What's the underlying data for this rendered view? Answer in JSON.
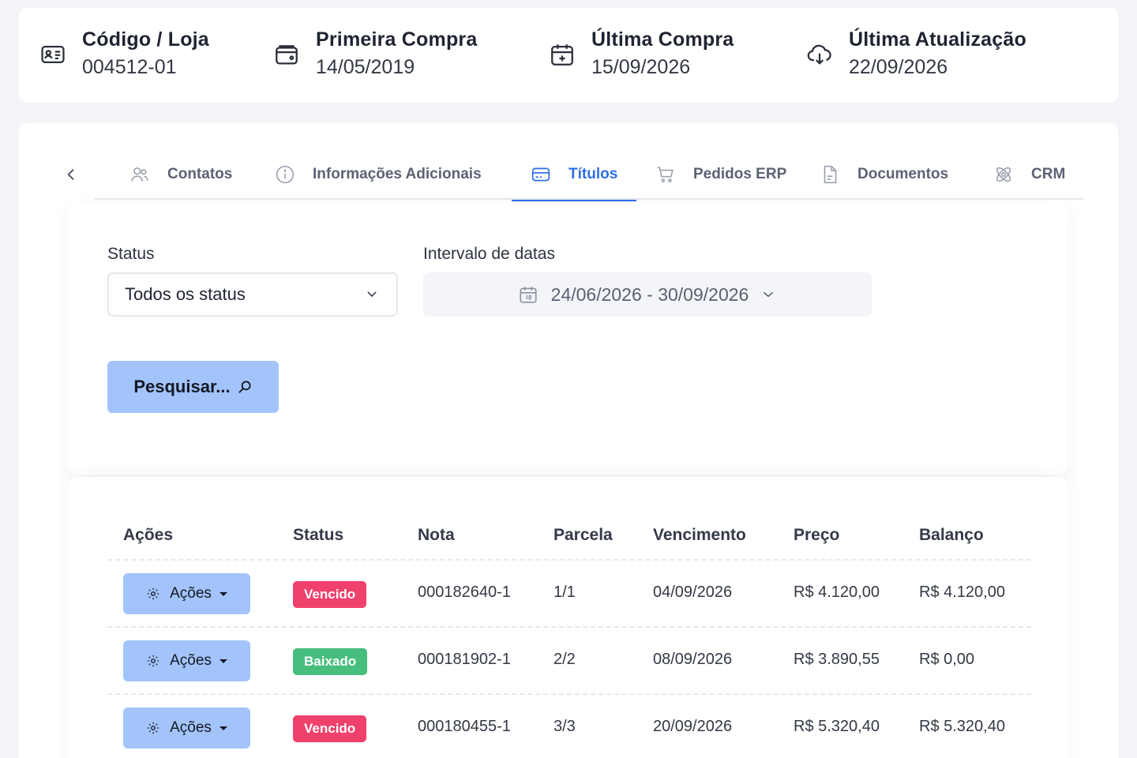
{
  "header": {
    "items": [
      {
        "label": "Código / Loja",
        "value": "004512-01",
        "icon": "id-card-icon"
      },
      {
        "label": "Primeira Compra",
        "value": "14/05/2019",
        "icon": "wallet-icon"
      },
      {
        "label": "Última Compra",
        "value": "15/09/2026",
        "icon": "calendar-plus-icon"
      },
      {
        "label": "Última Atualização",
        "value": "22/09/2026",
        "icon": "cloud-download-icon"
      }
    ]
  },
  "tabs": {
    "back_icon": "chevron-left-icon",
    "items": [
      {
        "label": "Contatos",
        "icon": "users-icon",
        "active": false
      },
      {
        "label": "Informações Adicionais",
        "icon": "info-icon",
        "active": false
      },
      {
        "label": "Títulos",
        "icon": "credit-card-icon",
        "active": true
      },
      {
        "label": "Pedidos ERP",
        "icon": "cart-icon",
        "active": false
      },
      {
        "label": "Documentos",
        "icon": "document-icon",
        "active": false
      },
      {
        "label": "CRM",
        "icon": "atom-icon",
        "active": false
      }
    ]
  },
  "filters": {
    "status_label": "Status",
    "status_value": "Todos os status",
    "date_label": "Intervalo de datas",
    "date_value": "24/06/2026 - 30/09/2026",
    "search_label": "Pesquisar..."
  },
  "table": {
    "columns": [
      "Ações",
      "Status",
      "Nota",
      "Parcela",
      "Vencimento",
      "Preço",
      "Balanço"
    ],
    "action_label": "Ações",
    "rows": [
      {
        "status": "Vencido",
        "status_color": "#f0416c",
        "nota": "000182640-1",
        "parcela": "1/1",
        "vencimento": "04/09/2026",
        "preco": "R$ 4.120,00",
        "balanco": "R$ 4.120,00"
      },
      {
        "status": "Baixado",
        "status_color": "#47be7d",
        "nota": "000181902-1",
        "parcela": "2/2",
        "vencimento": "08/09/2026",
        "preco": "R$ 3.890,55",
        "balanco": "R$ 0,00"
      },
      {
        "status": "Vencido",
        "status_color": "#f0416c",
        "nota": "000180455-1",
        "parcela": "3/3",
        "vencimento": "20/09/2026",
        "preco": "R$ 5.320,40",
        "balanco": "R$ 5.320,40"
      }
    ]
  },
  "colors": {
    "accent": "#2f6fe8",
    "button": "#a3c4fb",
    "danger": "#f0416c",
    "success": "#47be7d"
  }
}
